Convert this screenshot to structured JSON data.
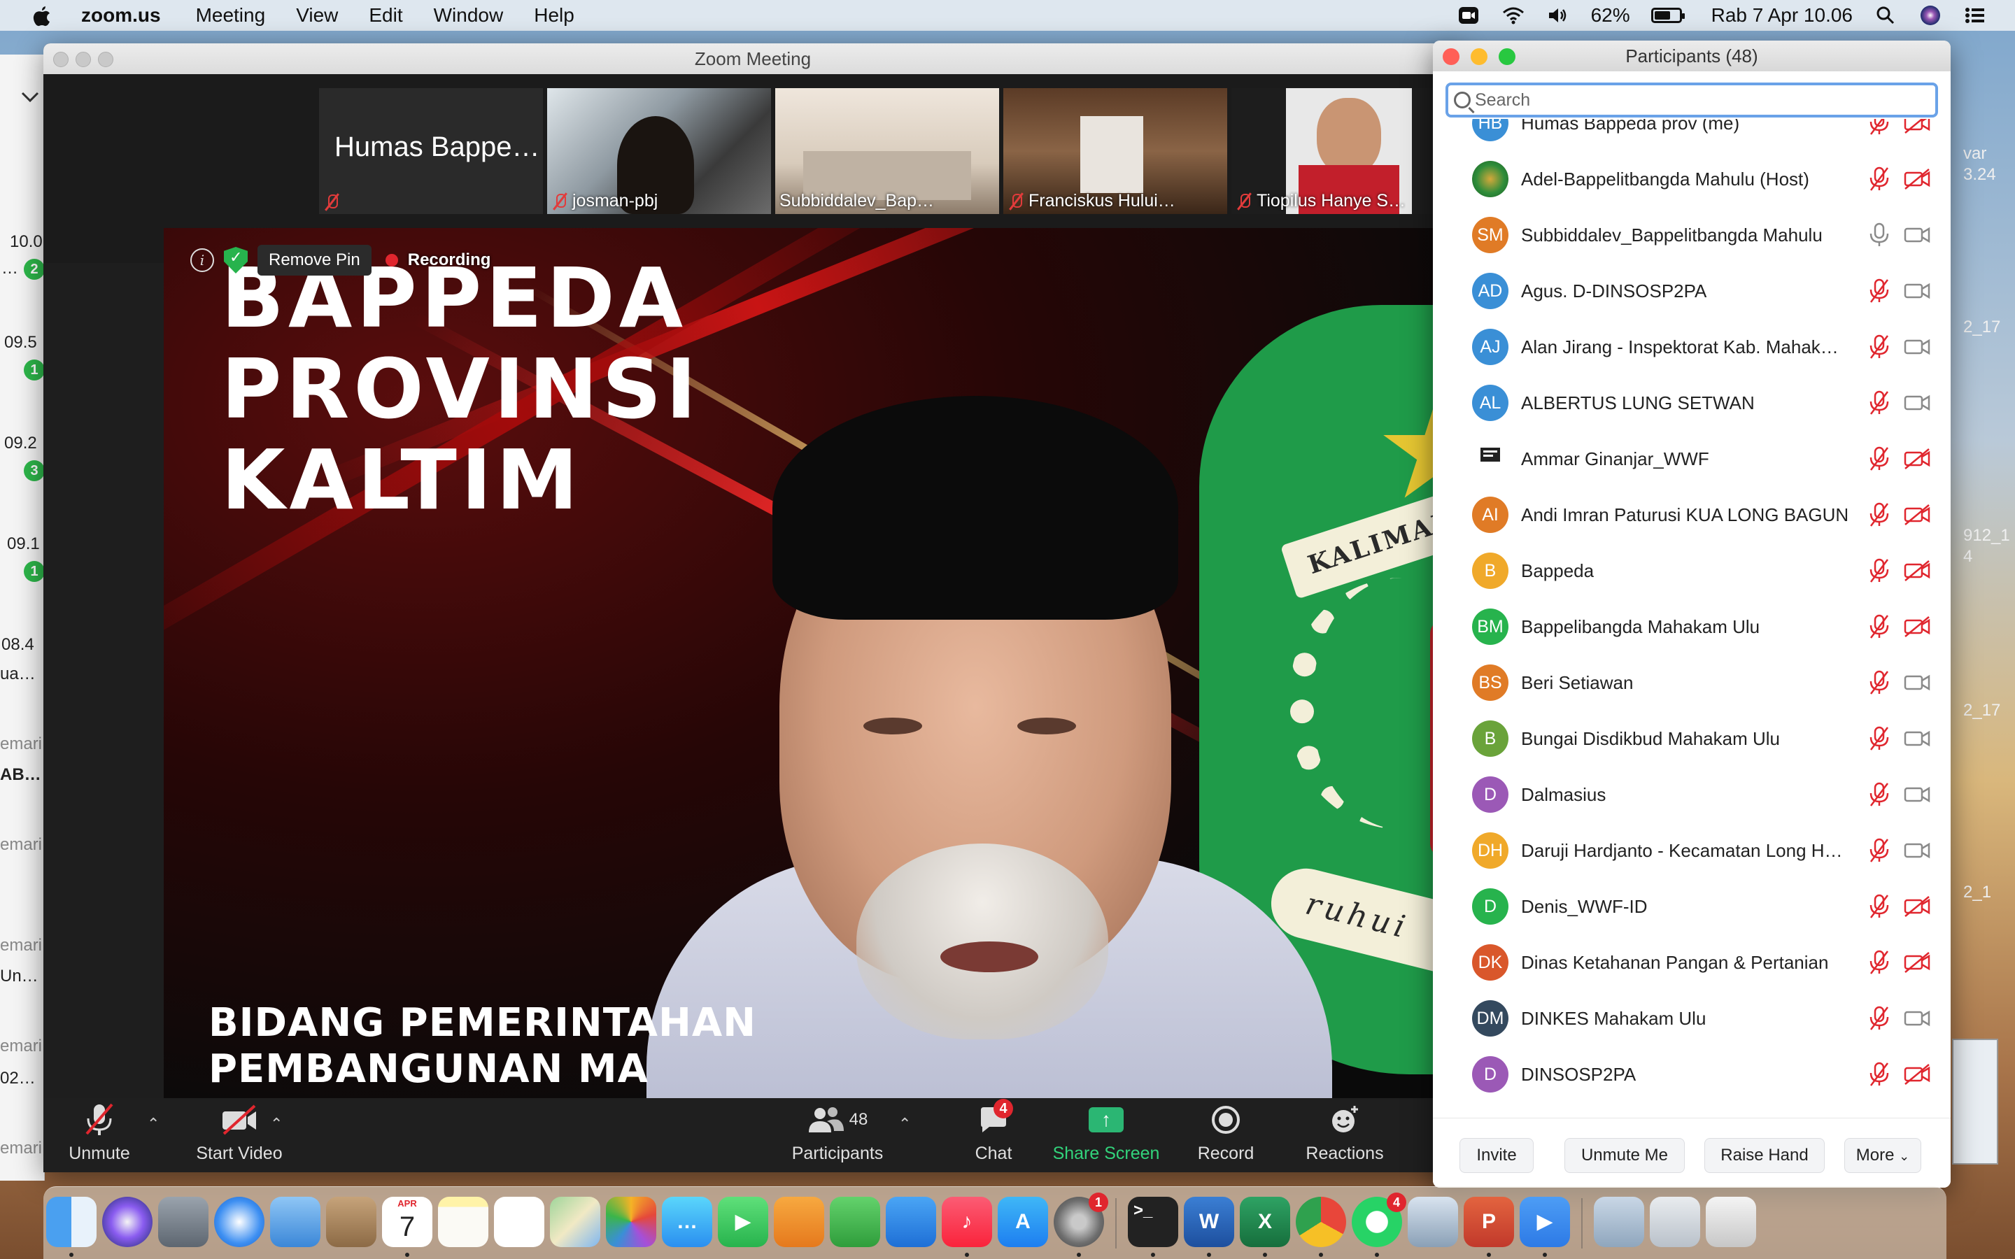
{
  "menubar": {
    "app_name": "zoom.us",
    "menus": [
      "Meeting",
      "View",
      "Edit",
      "Window",
      "Help"
    ],
    "battery_percent": "62%",
    "battery_level": 0.62,
    "datetime": "Rab 7 Apr  10.06",
    "icons": [
      "apple-icon",
      "zoom-status-icon",
      "wifi-icon",
      "volume-icon",
      "battery-icon",
      "search-icon",
      "siri-icon",
      "control-center-icon"
    ]
  },
  "background_app": {
    "times": [
      "10.0",
      "09.5",
      "09.2",
      "09.1",
      "08.4"
    ],
    "badges": [
      "2",
      "1",
      "3",
      "1"
    ],
    "snippets": [
      "…",
      "…",
      "ua…",
      "emari",
      "AB…",
      "emari",
      "emari",
      "Un…",
      "emari",
      "02…",
      "emari"
    ],
    "right_texts": [
      "var",
      "3.24",
      "2_17",
      "912_1",
      "4",
      "2_17",
      "2_1"
    ]
  },
  "zoom": {
    "title": "Zoom Meeting",
    "thumbnails": [
      {
        "label": "Humas Bappe…",
        "name": "",
        "muted": true,
        "type": "name-card"
      },
      {
        "label": "",
        "name": "josman-pbj",
        "muted": true,
        "type": "video"
      },
      {
        "label": "",
        "name": "Subbiddalev_Bap…",
        "muted": false,
        "type": "video"
      },
      {
        "label": "",
        "name": "Franciskus Hului…",
        "muted": true,
        "type": "video"
      },
      {
        "label": "",
        "name": "Tiopilus Hanye S…",
        "muted": true,
        "type": "video"
      }
    ],
    "overlay": {
      "remove_pin": "Remove Pin",
      "recording": "Recording"
    },
    "video_text": {
      "line1": "BAPPEDA",
      "line2": "PROVINSI",
      "line3": "KALTIM",
      "sub1": "BIDANG PEMERINTAHAN",
      "sub2": "PEMBANGUNAN MA",
      "ribbon": "KALIMANT",
      "motto": "ruhui"
    },
    "toolbar": {
      "unmute": "Unmute",
      "start_video": "Start Video",
      "participants": "Participants",
      "participants_count": "48",
      "chat": "Chat",
      "chat_badge": "4",
      "share_screen": "Share Screen",
      "record": "Record",
      "reactions": "Reactions"
    }
  },
  "participants_panel": {
    "title": "Participants (48)",
    "search_placeholder": "Search",
    "list": [
      {
        "initials": "HB",
        "name": "Humas Bappeda prov (me)",
        "color": "#3a8fd6",
        "mic": "muted",
        "cam": "off"
      },
      {
        "initials": "",
        "name": "Adel-Bappelitbangda Mahulu  (Host)",
        "color": "#2f8d3a",
        "mic": "muted",
        "cam": "off"
      },
      {
        "initials": "SM",
        "name": "Subbiddalev_Bappelitbangda Mahulu",
        "color": "#e07b26",
        "mic": "on",
        "cam": "on"
      },
      {
        "initials": "AD",
        "name": "Agus. D-DINSOSP2PA",
        "color": "#3a8fd6",
        "mic": "muted",
        "cam": "on"
      },
      {
        "initials": "AJ",
        "name": "Alan Jirang - Inspektorat Kab. Mahak…",
        "color": "#3a8fd6",
        "mic": "muted",
        "cam": "on"
      },
      {
        "initials": "AL",
        "name": "ALBERTUS LUNG SETWAN",
        "color": "#3a8fd6",
        "mic": "muted",
        "cam": "on"
      },
      {
        "initials": "",
        "name": "Ammar Ginanjar_WWF",
        "color": "#ffffff",
        "mic": "muted",
        "cam": "off"
      },
      {
        "initials": "AI",
        "name": "Andi Imran Paturusi KUA LONG BAGUN",
        "color": "#e07b26",
        "mic": "muted",
        "cam": "off"
      },
      {
        "initials": "B",
        "name": "Bappeda",
        "color": "#f0a92a",
        "mic": "muted",
        "cam": "off"
      },
      {
        "initials": "BM",
        "name": "Bappelibangda Mahakam Ulu",
        "color": "#27b34d",
        "mic": "muted",
        "cam": "off"
      },
      {
        "initials": "BS",
        "name": "Beri Setiawan",
        "color": "#e07b26",
        "mic": "muted",
        "cam": "on"
      },
      {
        "initials": "B",
        "name": "Bungai Disdikbud Mahakam Ulu",
        "color": "#6aa33a",
        "mic": "muted",
        "cam": "on"
      },
      {
        "initials": "D",
        "name": "Dalmasius",
        "color": "#9b59b6",
        "mic": "muted",
        "cam": "on"
      },
      {
        "initials": "DH",
        "name": "Daruji Hardjanto - Kecamatan Long H…",
        "color": "#f0a92a",
        "mic": "muted",
        "cam": "on"
      },
      {
        "initials": "D",
        "name": "Denis_WWF-ID",
        "color": "#27b34d",
        "mic": "muted",
        "cam": "off"
      },
      {
        "initials": "DK",
        "name": "Dinas Ketahanan Pangan & Pertanian",
        "color": "#d9572b",
        "mic": "muted",
        "cam": "off"
      },
      {
        "initials": "DM",
        "name": "DINKES Mahakam Ulu",
        "color": "#34495e",
        "mic": "muted",
        "cam": "on"
      },
      {
        "initials": "D",
        "name": "DINSOSP2PA",
        "color": "#9b59b6",
        "mic": "muted",
        "cam": "off"
      }
    ],
    "footer": {
      "invite": "Invite",
      "unmute_me": "Unmute Me",
      "raise_hand": "Raise Hand",
      "more": "More"
    }
  },
  "dock": {
    "calendar_month": "APR",
    "calendar_day": "7",
    "badges": {
      "system_prefs": "1",
      "whatsapp": "4"
    },
    "apps": [
      "finder-icon",
      "siri-icon",
      "launchpad-icon",
      "safari-icon",
      "mail-icon",
      "contacts-icon",
      "calendar-icon",
      "notes-icon",
      "reminders-icon",
      "maps-icon",
      "photos-icon",
      "messages-icon",
      "facetime-icon",
      "pages-icon",
      "numbers-icon",
      "keynote-icon",
      "music-icon",
      "app-store-icon",
      "system-preferences-icon",
      "terminal-icon",
      "word-icon",
      "excel-icon",
      "chrome-icon",
      "whatsapp-icon",
      "preview-icon",
      "powerpoint-icon",
      "zoom-icon",
      "documents-folder-icon",
      "downloads-icon",
      "trash-icon"
    ]
  }
}
